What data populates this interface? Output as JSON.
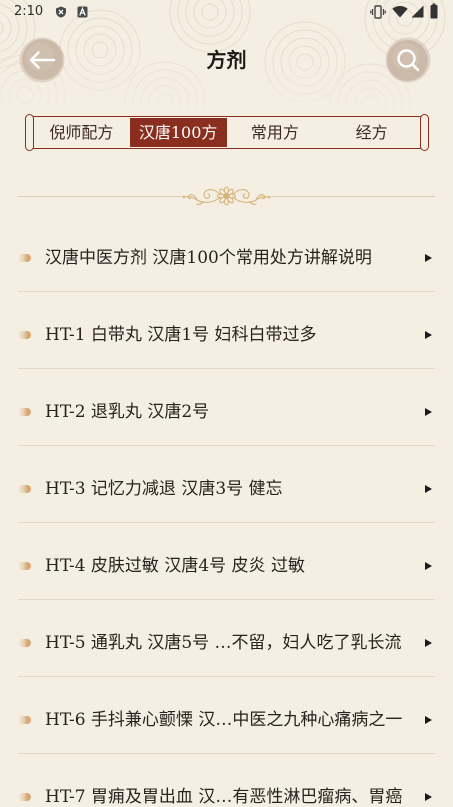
{
  "status_bar": {
    "time": "2:10",
    "left_icons": [
      "shield-icon",
      "a-icon"
    ],
    "right_icons": [
      "vibrate-icon",
      "wifi-icon",
      "signal-icon",
      "battery-icon"
    ]
  },
  "header": {
    "title": "方剂",
    "back_icon": "arrow-left-icon",
    "search_icon": "search-icon"
  },
  "tabs": [
    {
      "label": "倪师配方",
      "selected": false
    },
    {
      "label": "汉唐100方",
      "selected": true
    },
    {
      "label": "常用方",
      "selected": false
    },
    {
      "label": "经方",
      "selected": false
    }
  ],
  "divider_icon": "floral-ornament-icon",
  "list": {
    "bullet_icon": "dot-bullet-icon",
    "arrow_icon": "triangle-right-icon",
    "items": [
      {
        "text": "汉唐中医方剂 汉唐100个常用处方讲解说明"
      },
      {
        "text": "HT-1 白带丸 汉唐1号 妇科白带过多"
      },
      {
        "text": "HT-2 退乳丸 汉唐2号"
      },
      {
        "text": "HT-3 记忆力减退 汉唐3号 健忘"
      },
      {
        "text": "HT-4 皮肤过敏 汉唐4号 皮炎 过敏"
      },
      {
        "text": "HT-5 通乳丸 汉唐5号 …不留，妇人吃了乳长流"
      },
      {
        "text": "HT-6 手抖兼心颤慄 汉…中医之九种心痛病之一"
      },
      {
        "text": "HT-7 胃痈及胃出血 汉…有恶性淋巴瘤病、胃癌"
      }
    ]
  },
  "colors": {
    "background": "#f4eee3",
    "accent": "#8a2f1f",
    "text": "#2a231d",
    "bullet": "#d8a874",
    "ornament": "#d6b57a",
    "separator": "#e3d8c6",
    "button": "#cbbaa9"
  }
}
